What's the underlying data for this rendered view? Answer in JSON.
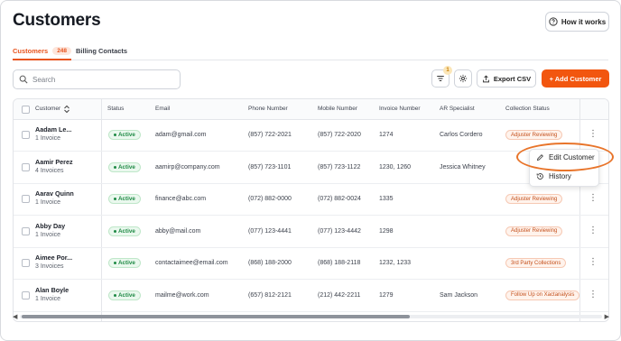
{
  "header": {
    "title": "Customers",
    "help_button": "How it works"
  },
  "tabs": [
    {
      "label": "Customers",
      "count": "248",
      "active": true
    },
    {
      "label": "Billing Contacts",
      "active": false
    }
  ],
  "toolbar": {
    "search_placeholder": "Search",
    "filter_count": "1",
    "export_label": "Export CSV",
    "add_label": "+ Add Customer"
  },
  "table": {
    "columns": [
      "Customer",
      "Status",
      "Email",
      "Phone Number",
      "Mobile Number",
      "Invoice Number",
      "AR Specialist",
      "Collection Status"
    ],
    "rows": [
      {
        "name": "Aadam Le...",
        "invoices": "1 Invoice",
        "status": "Active",
        "email": "adam@gmail.com",
        "phone": "(857) 722-2021",
        "mobile": "(857) 722-2020",
        "invoice_no": "1274",
        "specialist": "Carlos Cordero",
        "collection": "Adjuster Reviewing"
      },
      {
        "name": "Aamir Perez",
        "invoices": "4 Invoices",
        "status": "Active",
        "email": "aamirp@company.com",
        "phone": "(857) 723-1101",
        "mobile": "(857) 723-1122",
        "invoice_no": "1230, 1260",
        "specialist": "Jessica Whitney",
        "collection": ""
      },
      {
        "name": "Aarav Quinn",
        "invoices": "1 Invoice",
        "status": "Active",
        "email": "finance@abc.com",
        "phone": "(072) 882-0000",
        "mobile": "(072) 882-0024",
        "invoice_no": "1335",
        "specialist": "",
        "collection": "Adjuster Reviewing"
      },
      {
        "name": "Abby Day",
        "invoices": "1 Invoice",
        "status": "Active",
        "email": "abby@mail.com",
        "phone": "(077) 123-4441",
        "mobile": "(077) 123-4442",
        "invoice_no": "1298",
        "specialist": "",
        "collection": "Adjuster Reviewing"
      },
      {
        "name": "Aimee Por...",
        "invoices": "3 Invoices",
        "status": "Active",
        "email": "contactaimee@email.com",
        "phone": "(868) 188-2000",
        "mobile": "(868) 188-2118",
        "invoice_no": "1232, 1233",
        "specialist": "",
        "collection": "3rd Party Collections"
      },
      {
        "name": "Alan Boyle",
        "invoices": "1 Invoice",
        "status": "Active",
        "email": "mailme@work.com",
        "phone": "(657) 812-2121",
        "mobile": "(212) 442-2211",
        "invoice_no": "1279",
        "specialist": "Sam Jackson",
        "collection": "Follow Up on Xactanalysis"
      }
    ]
  },
  "context_menu": {
    "items": [
      "Edit Customer",
      "History"
    ]
  },
  "colors": {
    "accent": "#f2560f",
    "active_green": "#1f8a45",
    "highlight": "#e8742a"
  },
  "icons": [
    "help-icon",
    "search-icon",
    "filter-icon",
    "gear-icon",
    "export-icon",
    "sort-icon",
    "kebab-icon",
    "pencil-icon",
    "history-icon"
  ]
}
